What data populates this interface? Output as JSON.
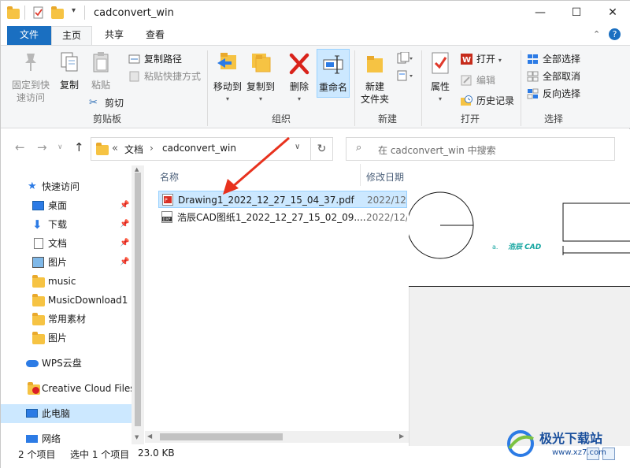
{
  "window": {
    "title": "cadconvert_win",
    "controls": {
      "minimize": "—",
      "maximize": "☐",
      "close": "✕"
    }
  },
  "ribbon_tabs": [
    "文件",
    "主页",
    "共享",
    "查看"
  ],
  "ribbon": {
    "clipboard": {
      "label": "剪贴板",
      "pin": "固定到快\n速访问",
      "copy": "复制",
      "paste": "粘贴",
      "copy_path": "复制路径",
      "paste_shortcut": "粘贴快捷方式",
      "cut": "剪切"
    },
    "organize": {
      "label": "组织",
      "move_to": "移动到",
      "copy_to": "复制到",
      "delete": "删除",
      "rename": "重命名"
    },
    "new": {
      "label": "新建",
      "new_folder": "新建\n文件夹"
    },
    "open": {
      "label": "打开",
      "properties": "属性",
      "open": "打开",
      "edit": "编辑",
      "history": "历史记录"
    },
    "select": {
      "label": "选择",
      "select_all": "全部选择",
      "select_none": "全部取消",
      "invert": "反向选择"
    }
  },
  "address": {
    "prefix": "«",
    "crumb_1": "文档",
    "crumb_2": "cadconvert_win",
    "sep": "›",
    "search_placeholder": "在 cadconvert_win 中搜索"
  },
  "nav": {
    "quick_access": "快速访问",
    "items": [
      {
        "label": "桌面",
        "pinned": true
      },
      {
        "label": "下载",
        "pinned": true
      },
      {
        "label": "文档",
        "pinned": true
      },
      {
        "label": "图片",
        "pinned": true
      },
      {
        "label": "music",
        "pinned": false
      },
      {
        "label": "MusicDownload1",
        "pinned": false
      },
      {
        "label": "常用素材",
        "pinned": false
      },
      {
        "label": "图片",
        "pinned": false
      }
    ],
    "wps": "WPS云盘",
    "creative_cloud": "Creative Cloud Files",
    "this_pc": "此电脑",
    "network": "网络"
  },
  "filelist": {
    "col_name": "名称",
    "col_date": "修改日期",
    "files": [
      {
        "name": "Drawing1_2022_12_27_15_04_37.pdf",
        "date": "2022/12/",
        "type": "pdf",
        "selected": true
      },
      {
        "name": "浩辰CAD图纸1_2022_12_27_15_02_09....",
        "date": "2022/12/",
        "type": "dxf",
        "selected": false
      }
    ]
  },
  "preview": {
    "small_text": "a.",
    "brand_text": "浩辰 CAD"
  },
  "status": {
    "item_count": "2 个项目",
    "selected": "选中 1 个项目",
    "size": "23.0 KB"
  },
  "watermark": {
    "text": "极光下载站",
    "url": "www.xz7.com"
  },
  "colors": {
    "accent": "#1a6fc1",
    "selection": "#cce8ff",
    "folder": "#f6c343",
    "arrow": "#e8321e"
  }
}
